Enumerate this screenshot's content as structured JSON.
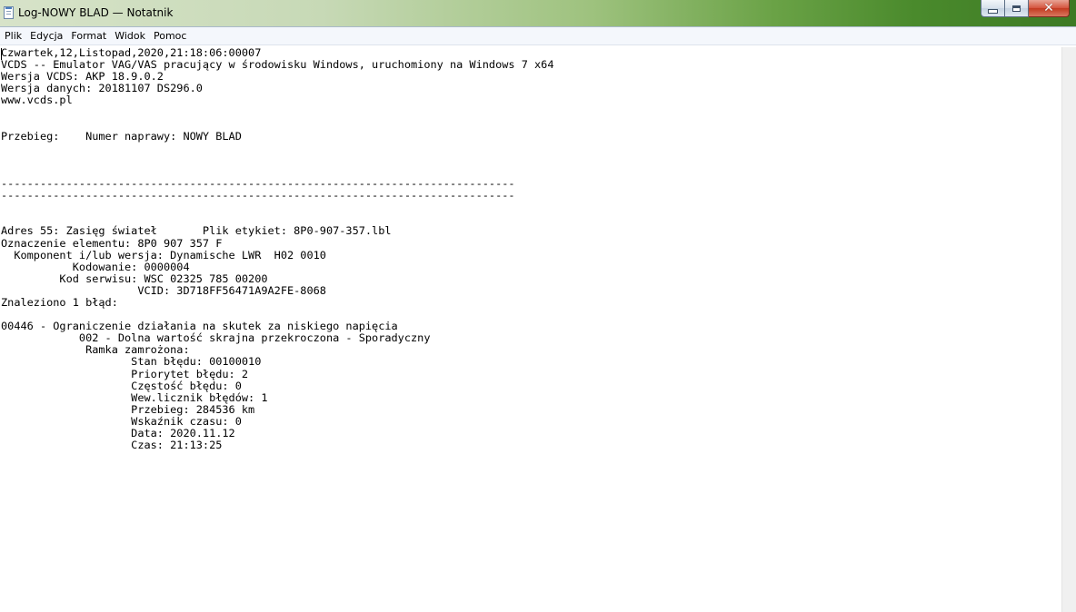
{
  "window": {
    "title": "Log-NOWY BLAD — Notatnik"
  },
  "menu": {
    "items": [
      "Plik",
      "Edycja",
      "Format",
      "Widok",
      "Pomoc"
    ]
  },
  "document": {
    "text": "Czwartek,12,Listopad,2020,21:18:06:00007\nVCDS -- Emulator VAG/VAS pracujący w środowisku Windows, uruchomiony na Windows 7 x64\nWersja VCDS: AKP 18.9.0.2\nWersja danych: 20181107 DS296.0\nwww.vcds.pl\n\n\nPrzebieg:    Numer naprawy: NOWY BLAD\n\n\n\n-------------------------------------------------------------------------------\n-------------------------------------------------------------------------------\n\n\nAdres 55: Zasięg świateł       Plik etykiet: 8P0-907-357.lbl\nOznaczenie elementu: 8P0 907 357 F\n  Komponent i/lub wersja: Dynamische LWR  H02 0010\n           Kodowanie: 0000004\n         Kod serwisu: WSC 02325 785 00200\n                     VCID: 3D718FF56471A9A2FE-8068\nZnaleziono 1 błąd:\n\n00446 - Ograniczenie działania na skutek za niskiego napięcia\n            002 - Dolna wartość skrajna przekroczona - Sporadyczny\n             Ramka zamrożona:\n                    Stan błędu: 00100010\n                    Priorytet błędu: 2\n                    Częstość błędu: 0\n                    Wew.licznik błędów: 1\n                    Przebieg: 284536 km\n                    Wskaźnik czasu: 0\n                    Data: 2020.11.12\n                    Czas: 21:13:25"
  },
  "icons": {
    "app": "notepad-icon",
    "minimize": "minimize-icon",
    "maximize": "maximize-icon",
    "close": "close-icon"
  },
  "colors": {
    "close_button": "#c33a20",
    "editor_background": "#ffffff",
    "text": "#000000"
  }
}
